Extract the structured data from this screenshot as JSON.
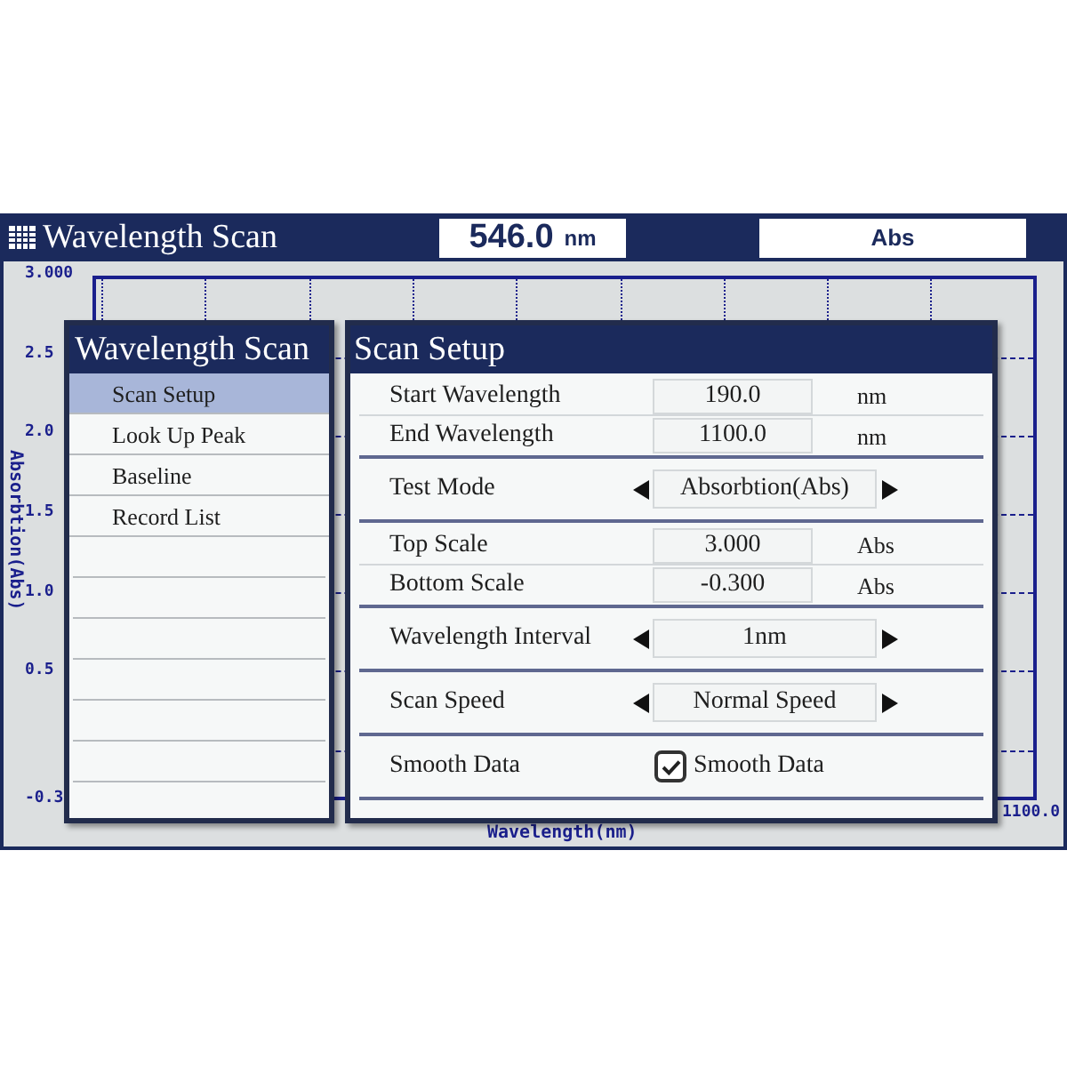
{
  "header": {
    "title": "Wavelength Scan",
    "wavelength": "546.0",
    "wavelength_unit": "nm",
    "mode": "Abs"
  },
  "plot": {
    "y_axis_label": "Absorbtion(Abs)",
    "x_axis_label": "Wavelength(nm)",
    "y_ticks": [
      "3.000",
      "2.5",
      "2.0",
      "1.5",
      "1.0",
      "0.5",
      "-0.3"
    ],
    "x_ticks": [
      "1100.0"
    ]
  },
  "menu": {
    "title": "Wavelength Scan",
    "items": [
      {
        "label": "Scan Setup",
        "selected": true
      },
      {
        "label": "Look Up Peak",
        "selected": false
      },
      {
        "label": "Baseline",
        "selected": false
      },
      {
        "label": "Record List",
        "selected": false
      }
    ]
  },
  "setup": {
    "title": "Scan Setup",
    "groups": [
      {
        "rows": [
          {
            "kind": "number",
            "label": "Start Wavelength",
            "value": "190.0",
            "unit": "nm"
          },
          {
            "kind": "number",
            "label": "End Wavelength",
            "value": "1100.0",
            "unit": "nm"
          }
        ]
      },
      {
        "rows": [
          {
            "kind": "choice",
            "label": "Test Mode",
            "value": "Absorbtion(Abs)"
          }
        ]
      },
      {
        "rows": [
          {
            "kind": "number",
            "label": "Top Scale",
            "value": "3.000",
            "unit": "Abs"
          },
          {
            "kind": "number",
            "label": "Bottom Scale",
            "value": "-0.300",
            "unit": "Abs"
          }
        ]
      },
      {
        "rows": [
          {
            "kind": "choice",
            "label": "Wavelength Interval",
            "value": "1nm"
          }
        ]
      },
      {
        "rows": [
          {
            "kind": "choice",
            "label": "Scan Speed",
            "value": "Normal Speed"
          }
        ]
      },
      {
        "rows": [
          {
            "kind": "checkbox",
            "label": "Smooth Data",
            "option": "Smooth Data",
            "checked": true
          }
        ]
      }
    ]
  }
}
